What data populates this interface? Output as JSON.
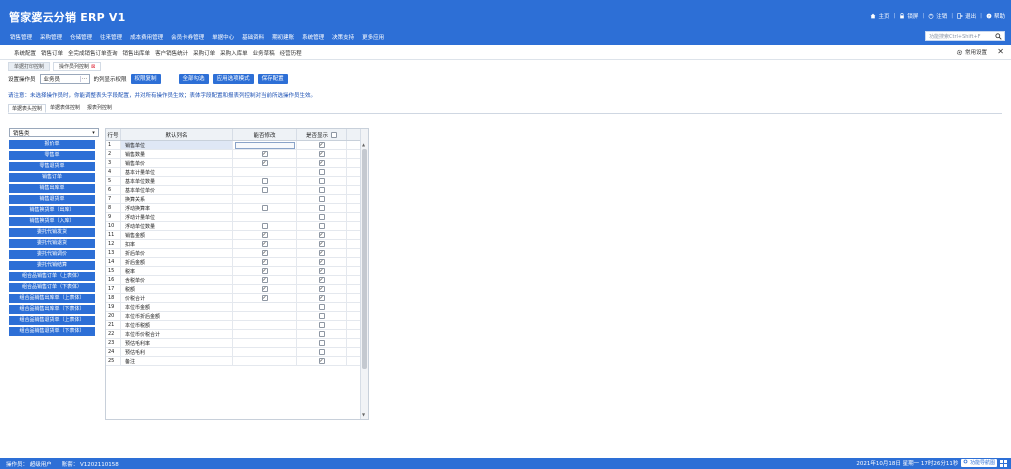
{
  "app": {
    "title": "管家婆云分销 ERP V1"
  },
  "topright": {
    "home": "主页",
    "lock": "锁屏",
    "logout": "注销",
    "exit": "退出",
    "help": "帮助"
  },
  "menu": [
    "销售管理",
    "采购管理",
    "仓储管理",
    "往来管理",
    "成本费用管理",
    "会员卡券管理",
    "单据中心",
    "基础资料",
    "期初建账",
    "系统管理",
    "决策支持",
    "更多应用"
  ],
  "search": {
    "placeholder": "功能搜索Ctrl+Shift+F"
  },
  "quicklinks": [
    "系统配置",
    "销售订单",
    "全完成销售订单查询",
    "销售出库单",
    "客户销售统计",
    "采购订单",
    "采购入库单",
    "业务草稿",
    "经营历程"
  ],
  "common": {
    "label": "常用设置"
  },
  "pagetabs": [
    {
      "label": "单据打印控制",
      "close": ""
    },
    {
      "label": "操作员列控制",
      "close": "⊠"
    }
  ],
  "toolbar": {
    "operator_label": "设置操作员",
    "operator_value": "业务员",
    "dots": "···",
    "scope_label": "的列显示权限",
    "permission_copy": "权限复制",
    "check_all": "全部勾选",
    "apply_template": "应用选项模式",
    "save_config": "保存配置"
  },
  "note": "请注意：未选择操作员时，你能调整表头字段配置，并对所有操作员生效；表体字段配置和报表列控制对当前所选操作员生效。",
  "subtabs": [
    "单据表头控制",
    "单据表体控制",
    "报表列控制"
  ],
  "left": {
    "dropdown": "销售类",
    "items": [
      "报价单",
      "零售单",
      "零售退货单",
      "销售订单",
      "销售出库单",
      "销售退货单",
      "销售换货单（出库）",
      "销售换货单（入库）",
      "委托代销发货",
      "委托代销退货",
      "委托代销调价",
      "委托代销结算",
      "组合品销售订单（上表体）",
      "组合品销售订单（下表体）",
      "组合品销售出库单（上表体）",
      "组合品销售出库单（下表体）",
      "组合品销售退货单（上表体）",
      "组合品销售退货单（下表体）"
    ]
  },
  "grid": {
    "headers": {
      "no": "行号",
      "name": "默认列名",
      "readonly": "能否修改",
      "visible": "是否显示"
    },
    "rows": [
      {
        "no": "1",
        "name": "销售单位",
        "edit": null,
        "show": true
      },
      {
        "no": "2",
        "name": "销售数量",
        "edit": true,
        "show": true
      },
      {
        "no": "3",
        "name": "销售单价",
        "edit": true,
        "show": true
      },
      {
        "no": "4",
        "name": "基本计量单位",
        "edit": null,
        "show": false
      },
      {
        "no": "5",
        "name": "基本单位数量",
        "edit": false,
        "show": false
      },
      {
        "no": "6",
        "name": "基本单位单价",
        "edit": false,
        "show": false
      },
      {
        "no": "7",
        "name": "换算关系",
        "edit": null,
        "show": false
      },
      {
        "no": "8",
        "name": "浮动换算率",
        "edit": false,
        "show": false
      },
      {
        "no": "9",
        "name": "浮动计量单位",
        "edit": null,
        "show": false
      },
      {
        "no": "10",
        "name": "浮动单位数量",
        "edit": false,
        "show": false
      },
      {
        "no": "11",
        "name": "销售金额",
        "edit": true,
        "show": true
      },
      {
        "no": "12",
        "name": "扣率",
        "edit": true,
        "show": true
      },
      {
        "no": "13",
        "name": "折后单价",
        "edit": true,
        "show": true
      },
      {
        "no": "14",
        "name": "折后金额",
        "edit": true,
        "show": true
      },
      {
        "no": "15",
        "name": "税率",
        "edit": true,
        "show": true
      },
      {
        "no": "16",
        "name": "含税单价",
        "edit": true,
        "show": true
      },
      {
        "no": "17",
        "name": "税额",
        "edit": true,
        "show": true
      },
      {
        "no": "18",
        "name": "价税合计",
        "edit": true,
        "show": true
      },
      {
        "no": "19",
        "name": "本位币金额",
        "edit": null,
        "show": false
      },
      {
        "no": "20",
        "name": "本位币折后金额",
        "edit": null,
        "show": false
      },
      {
        "no": "21",
        "name": "本位币税额",
        "edit": null,
        "show": false
      },
      {
        "no": "22",
        "name": "本位币价税合计",
        "edit": null,
        "show": false
      },
      {
        "no": "23",
        "name": "预估毛利率",
        "edit": null,
        "show": false
      },
      {
        "no": "24",
        "name": "预估毛利",
        "edit": null,
        "show": false
      },
      {
        "no": "25",
        "name": "备注",
        "edit": null,
        "show": true
      }
    ]
  },
  "footer": {
    "operator": "操作员：  超级用户",
    "account": "账套：  V1202110158",
    "datetime": "2021年10月18日 星期一  17时26分11秒",
    "shortcut": "功能导航图"
  },
  "colors": {
    "primary": "#2d6fd6"
  }
}
